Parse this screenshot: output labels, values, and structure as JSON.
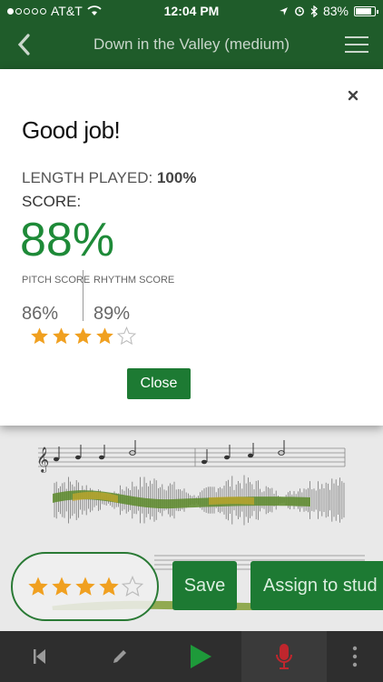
{
  "status_bar": {
    "carrier": "AT&T",
    "time": "12:04 PM",
    "battery": "83%",
    "battery_level": 0.83
  },
  "nav": {
    "title": "Down in the Valley (medium)"
  },
  "result": {
    "heading": "Good job!",
    "length_label": "LENGTH PLAYED:",
    "length_value": "100%",
    "score_label": "SCORE:",
    "score_value": "88%",
    "pitch_label": "PITCH SCORE",
    "pitch_value": "86%",
    "rhythm_label": "RHYTHM SCORE",
    "rhythm_value": "89%",
    "rating": 4,
    "rating_max": 5,
    "close_label": "Close"
  },
  "controls": {
    "save_label": "Save",
    "assign_label": "Assign to stud",
    "rating": 4,
    "rating_max": 5
  },
  "colors": {
    "brand": "#1f5c2a",
    "accent": "#1d7a33",
    "score": "#1e8a38",
    "star": "#f0a020",
    "record": "#c0262d"
  },
  "icons": [
    "back-icon",
    "menu-icon",
    "close-icon",
    "skip-back-icon",
    "pencil-icon",
    "play-icon",
    "microphone-icon",
    "more-icon"
  ]
}
